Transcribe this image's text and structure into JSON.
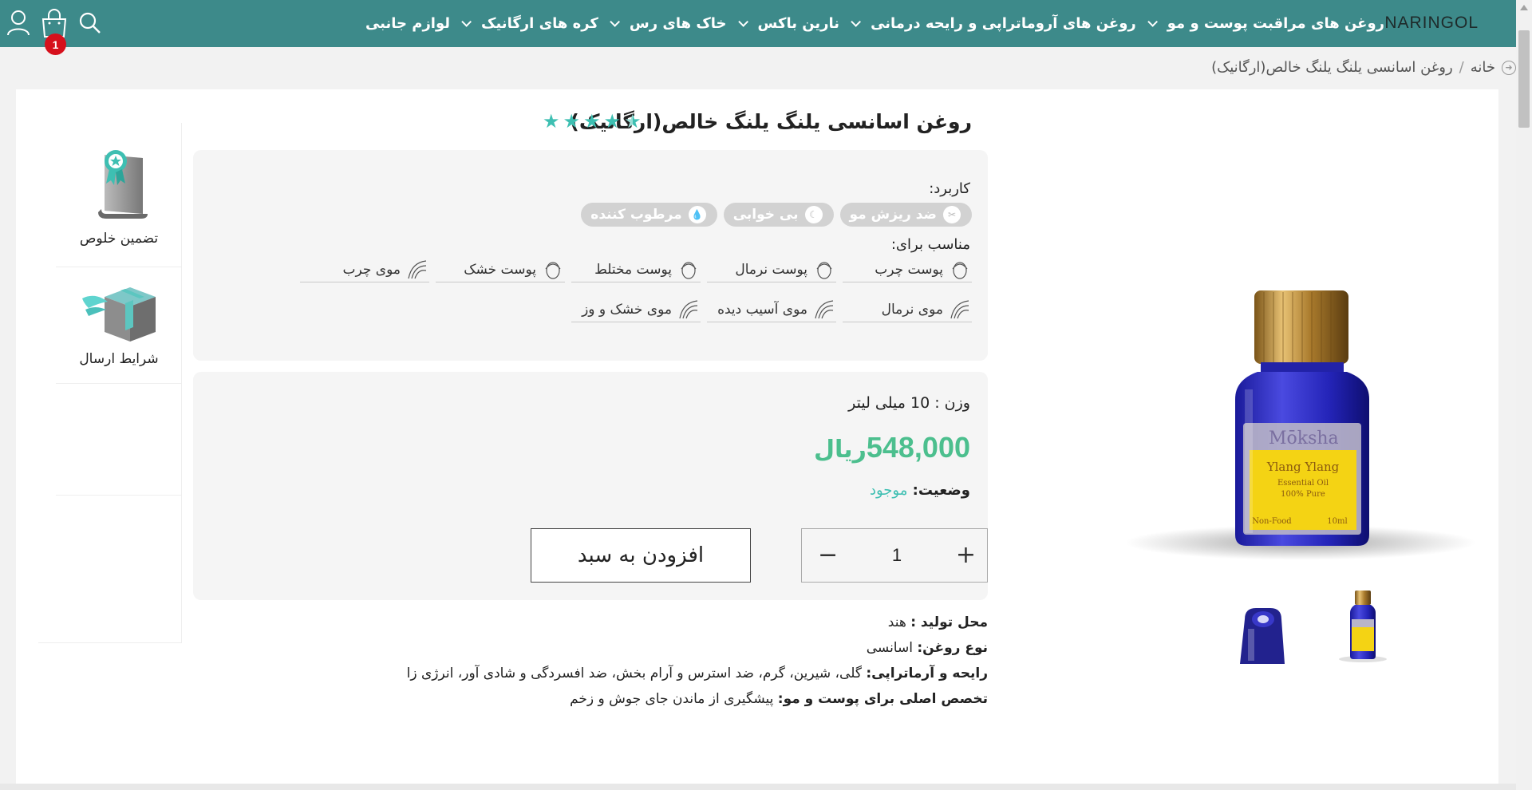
{
  "header": {
    "logo": "NARINGOL",
    "nav": [
      {
        "label": "روغن های مراقبت پوست و مو"
      },
      {
        "label": "روغن های آروماتراپی و رایحه درمانی"
      },
      {
        "label": "نارین باکس"
      },
      {
        "label": "خاک های رس"
      },
      {
        "label": "کره های ارگانیک"
      },
      {
        "label": "لوازم جانبی"
      }
    ],
    "cart_count": "1",
    "icons": [
      "search-icon",
      "cart-icon",
      "user-icon"
    ]
  },
  "breadcrumb": {
    "home": "خانه",
    "current": "روغن اسانسی یلنگ یلنگ خالص(ارگانیک)"
  },
  "product": {
    "title": "روغن اسانسی یلنگ یلنگ خالص(ارگانیک)",
    "rating": 4.5,
    "usage_label": "کاربرد:",
    "usage": [
      {
        "label": "ضد ریزش مو",
        "icon": "scissors-icon"
      },
      {
        "label": "بی خوابی",
        "icon": "moon-icon"
      },
      {
        "label": "مرطوب کننده",
        "icon": "drop-icon"
      }
    ],
    "suitable_label": "مناسب برای:",
    "suitable": [
      {
        "label": "پوست چرب",
        "icon": "face-icon"
      },
      {
        "label": "پوست نرمال",
        "icon": "face-icon"
      },
      {
        "label": "پوست مختلط",
        "icon": "face-icon"
      },
      {
        "label": "پوست خشک",
        "icon": "face-icon"
      },
      {
        "label": "موی چرب",
        "icon": "hair-icon"
      },
      {
        "label": "موی نرمال",
        "icon": "hair-icon"
      },
      {
        "label": "موی آسیب دیده",
        "icon": "hair-icon"
      },
      {
        "label": "موی خشک و وز",
        "icon": "hair-icon"
      }
    ],
    "weight": "وزن : 10 میلی لیتر",
    "price": "548,000",
    "currency": "ریال",
    "status_label": "وضعیت:",
    "status_value": "موجود",
    "quantity": "1",
    "qty_plus": "+",
    "qty_minus": "−",
    "add_to_cart": "افزودن به سبد",
    "specs": [
      {
        "label": "محل تولید :",
        "value": " هند"
      },
      {
        "label": "نوع روغن:",
        "value": " اسانسی"
      },
      {
        "label": "رایحه و آرماتراپی:",
        "value": " گلی، شیرین، گرم، ضد استرس و آرام بخش، ضد افسردگی و شادی آور، انرژی زا"
      },
      {
        "label": "تخصص اصلی برای پوست و مو:",
        "value": " پیشگیری از ماندن جای جوش و زخم"
      }
    ],
    "bottle_label": {
      "brand": "Mōksha",
      "name": "Ylang Ylang",
      "line1": "Essential Oil",
      "line2": "100% Pure",
      "food": "Non-Food",
      "vol": "10ml"
    }
  },
  "sidebar": {
    "items": [
      {
        "label": "تضمین خلوص",
        "icon": "certificate-icon"
      },
      {
        "label": "شرایط ارسال",
        "icon": "shipping-box-icon"
      }
    ]
  },
  "colors": {
    "header": "#3d8a8a",
    "accent": "#3ebfb2",
    "price": "#4cbf8e",
    "badge": "#d6101c"
  }
}
